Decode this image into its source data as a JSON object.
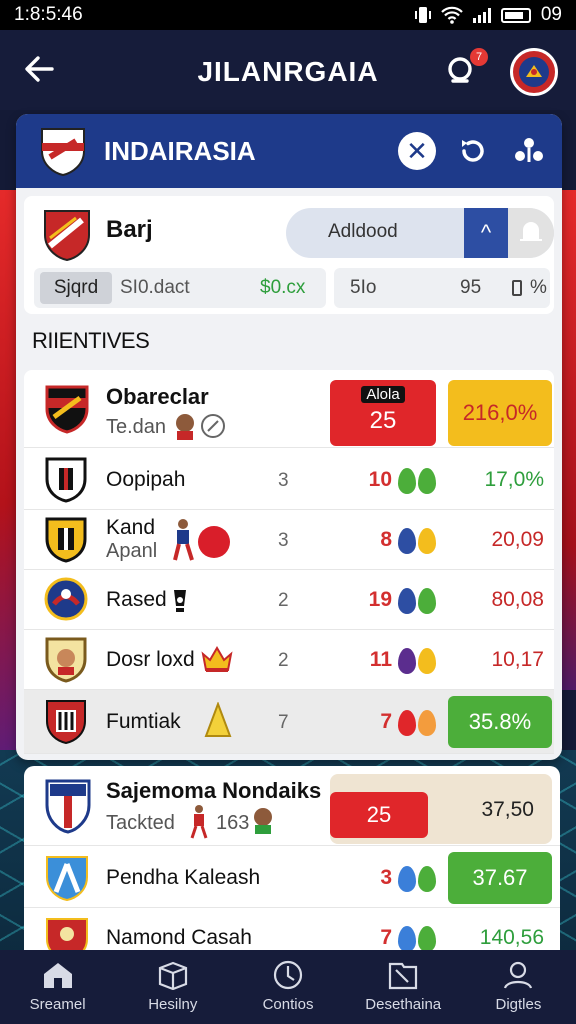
{
  "status_bar": {
    "time": "1:8:5:46",
    "battery_text": "09"
  },
  "header": {
    "title": "JILANRGAIA",
    "notification_count": "7"
  },
  "league": {
    "name": "INDAIRASIA"
  },
  "team": {
    "name": "Barj",
    "follow_label": "Adldood",
    "stats": {
      "chip": "Sjqrd",
      "text": "SI0.dact",
      "green_value": "$0.cx",
      "b_label": "5Io",
      "b_value": "95",
      "b_unit": "%"
    }
  },
  "section": {
    "heading": "RIIENTIVES"
  },
  "rows": [
    {
      "name": "Obareclar",
      "sub": "Te.dan",
      "pill_red": "25",
      "pill_red_top": "Alola",
      "pct": "216,0%"
    },
    {
      "name": "Oopipah",
      "pos": "3",
      "pts": "10",
      "pct": "17,0%"
    },
    {
      "name": "Kand",
      "sub": "Apanl",
      "pos": "3",
      "pts": "8",
      "pct": "20,09"
    },
    {
      "name": "Rased",
      "pos": "2",
      "pts": "19",
      "pct": "80,08"
    },
    {
      "name": "Dosr loxd",
      "pos": "2",
      "pts": "11",
      "pct": "10,17"
    },
    {
      "name": "Fumtiak",
      "pos": "7",
      "pts": "7",
      "pct": "35.8%"
    }
  ],
  "second": [
    {
      "name": "Sajemoma Nondaiks",
      "sub": "Tackted",
      "sub_num": "163",
      "pill": "25",
      "pct": "37,50"
    },
    {
      "name": "Pendha Kaleash",
      "pts": "3",
      "pct": "37.67"
    },
    {
      "name": "Namond Casah",
      "pts": "7",
      "pct": "140,56"
    }
  ],
  "nav": [
    {
      "label": "Sreamel",
      "icon": "home-icon"
    },
    {
      "label": "Hesilny",
      "icon": "box-icon"
    },
    {
      "label": "Contios",
      "icon": "compass-icon"
    },
    {
      "label": "Desethaina",
      "icon": "book-icon"
    },
    {
      "label": "Digtles",
      "icon": "profile-icon"
    }
  ],
  "colors": {
    "header": "#161c3a",
    "league_bar": "#1e3a8a",
    "accent_red": "#e0262a",
    "accent_green": "#4cae3a",
    "accent_amber": "#f3bd1d"
  }
}
